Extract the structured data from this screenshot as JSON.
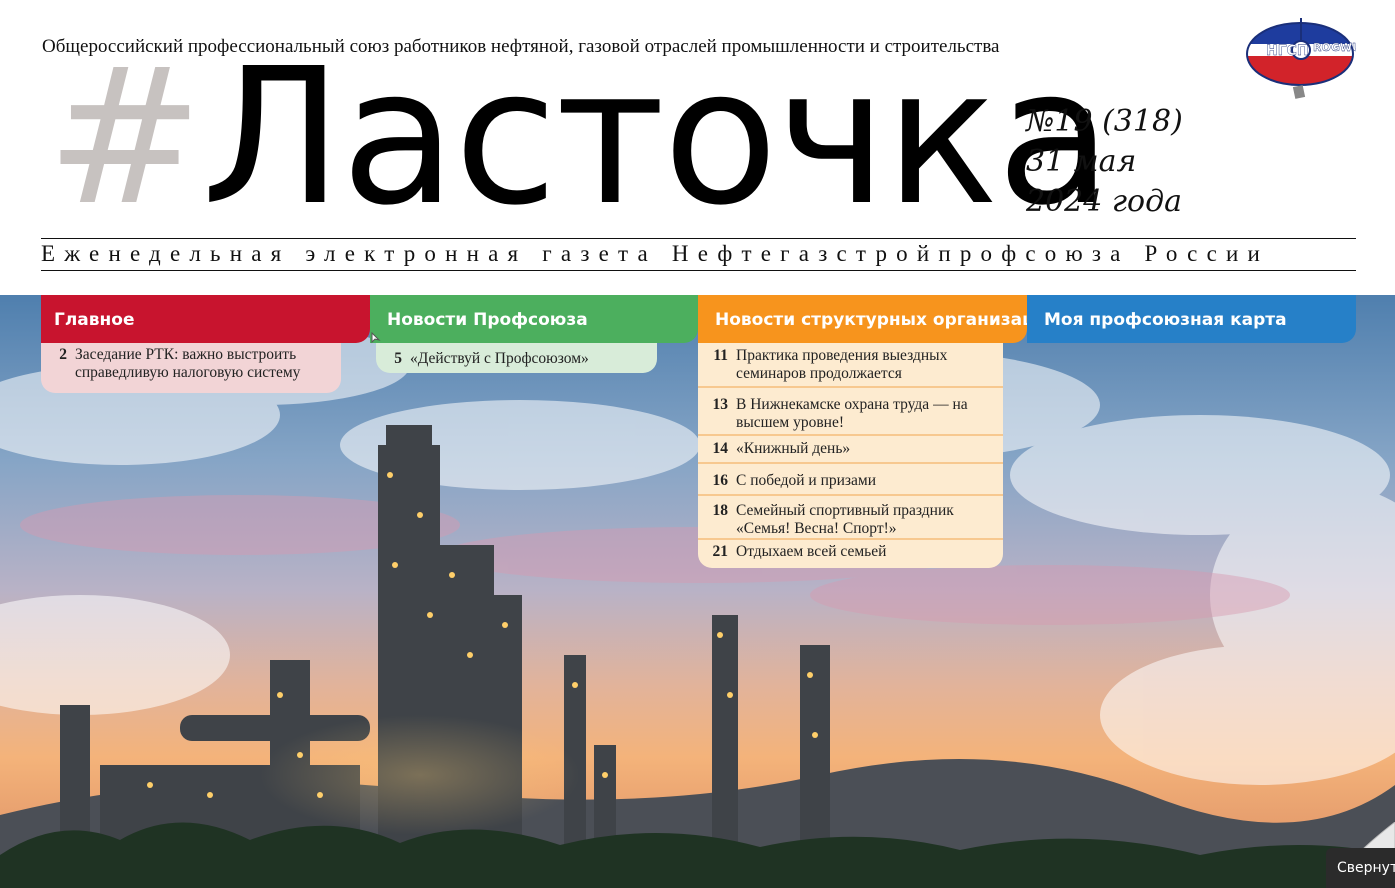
{
  "header": {
    "org_line": "Общероссийский профессиональный союз работников нефтяной, газовой отраслей промышленности и строительства",
    "masthead_hash": "#",
    "masthead_title": "Ласточка",
    "issue_number": "№19 (318)",
    "issue_day": "31 мая",
    "issue_year": "2024 года",
    "tagline": "Еженедельная электронная газета Нефтегазстройпрофсоюза России",
    "logo": {
      "left": "НГСП",
      "right": "ROGWU"
    }
  },
  "tabs": [
    {
      "label": "Главное",
      "color": "#c8142e"
    },
    {
      "label": "Новости Профсоюза",
      "color": "#4caf5e"
    },
    {
      "label": "Новости структурных организаций",
      "color": "#f7941d"
    },
    {
      "label": "Моя профсоюзная карта",
      "color": "#2680c8"
    }
  ],
  "main_items": [
    {
      "page": "2",
      "text": "Заседание РТК: важно выстроить справедливую налоговую систему"
    }
  ],
  "union_items": [
    {
      "page": "5",
      "text": "«Действуй с Профсоюзом»"
    }
  ],
  "org_items": [
    {
      "page": "11",
      "text": "Практика проведения выездных семинаров продолжается"
    },
    {
      "page": "13",
      "text": "В Нижнекамске охрана труда — на высшем уровне!"
    },
    {
      "page": "14",
      "text": "«Книжный день»"
    },
    {
      "page": "16",
      "text": "С победой и призами"
    },
    {
      "page": "18",
      "text": "Семейный спортивный праздник «Семья! Весна! Спорт!»"
    },
    {
      "page": "21",
      "text": "Отдыхаем всей семьей"
    }
  ],
  "collapse_label": "Свернут"
}
